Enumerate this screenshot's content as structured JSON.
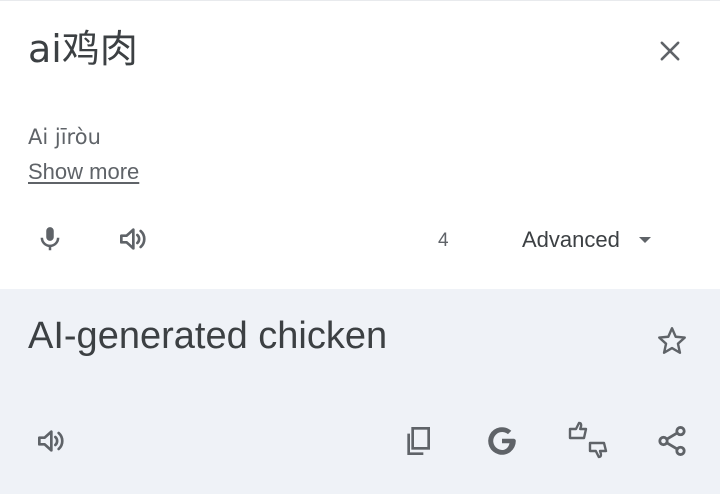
{
  "source": {
    "text": "ai鸡肉",
    "transliteration": "Ai jīròu",
    "show_more_label": "Show more",
    "char_count": "4",
    "advanced_label": "Advanced"
  },
  "target": {
    "text": "AI-generated chicken"
  },
  "icons": {
    "close": "close-icon",
    "mic": "mic-icon",
    "speaker": "volume-icon",
    "dropdown": "arrow-drop-down-icon",
    "star": "star-outline-icon",
    "copy": "copy-icon",
    "google": "google-g-icon",
    "feedback": "thumbs-feedback-icon",
    "share": "share-icon"
  },
  "colors": {
    "icon": "#5f6368",
    "text": "#3c4043",
    "target_bg": "#eff2f7"
  }
}
